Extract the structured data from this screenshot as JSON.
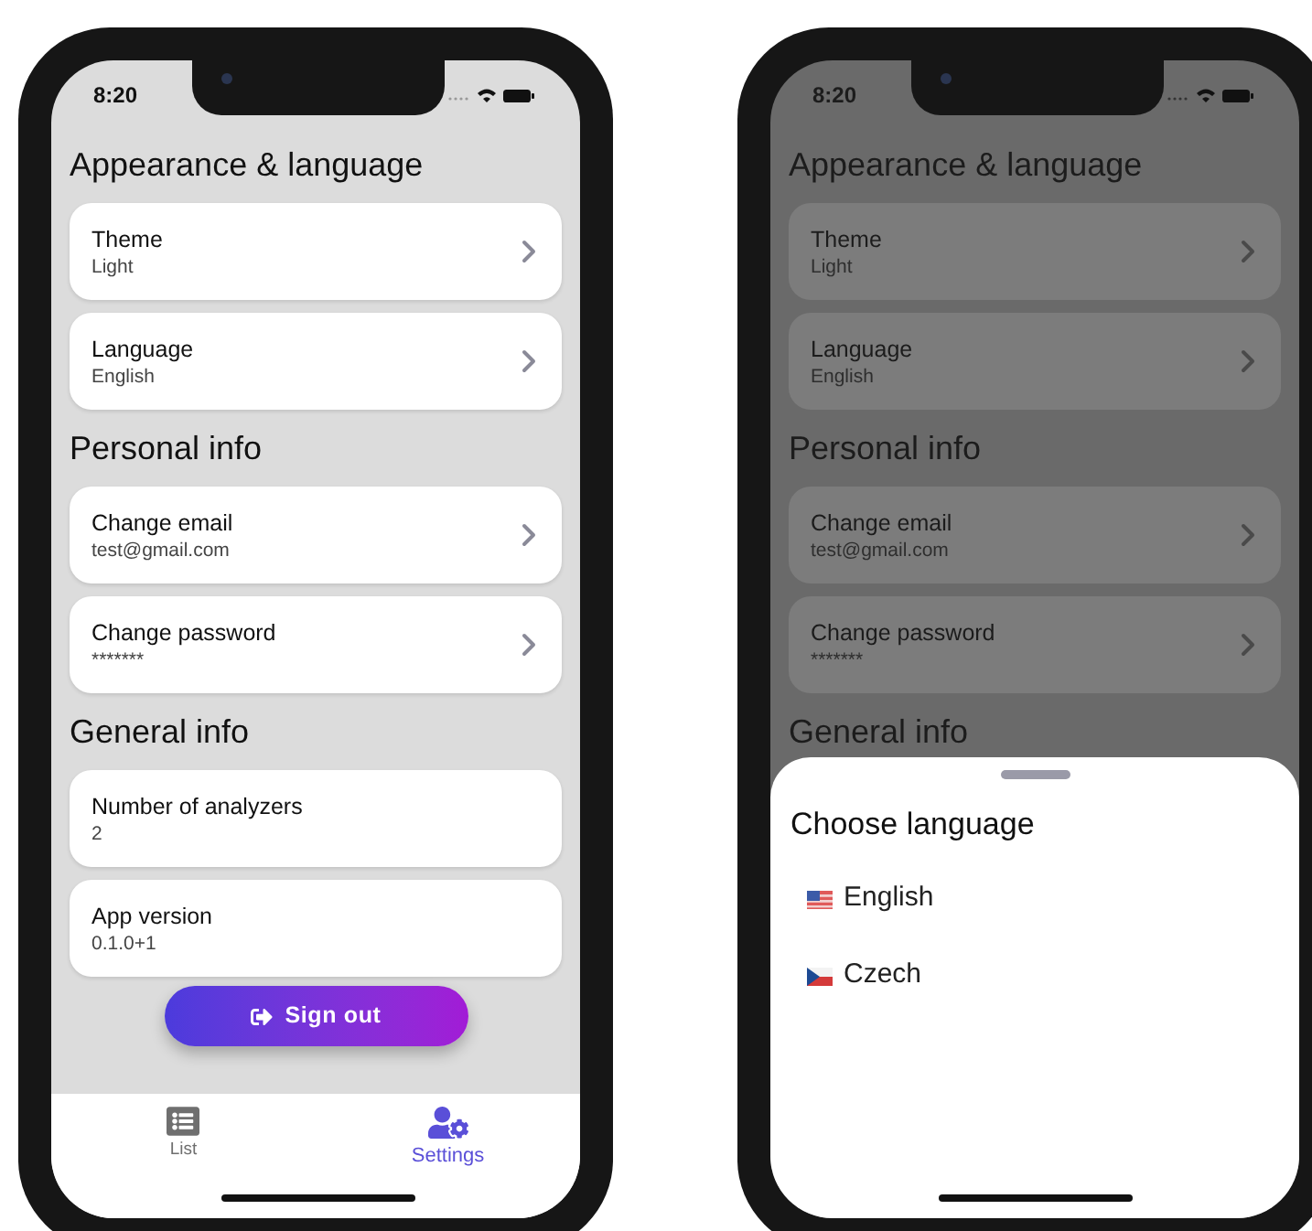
{
  "phones": [
    {
      "dimmed": false,
      "time": "8:20",
      "sections": [
        {
          "title": "Appearance & language",
          "items": [
            {
              "label": "Theme",
              "value": "Light",
              "link": true
            },
            {
              "label": "Language",
              "value": "English",
              "link": true
            }
          ]
        },
        {
          "title": "Personal info",
          "items": [
            {
              "label": "Change email",
              "value": "test@gmail.com",
              "link": true
            },
            {
              "label": "Change password",
              "value": "*******",
              "link": true
            }
          ]
        },
        {
          "title": "General info",
          "items": [
            {
              "label": "Number of analyzers",
              "value": "2",
              "link": false
            },
            {
              "label": "App version",
              "value": "0.1.0+1",
              "link": false
            }
          ]
        }
      ],
      "sign_out": "Sign out",
      "nav": [
        {
          "label": "List",
          "kind": "list",
          "selected": false
        },
        {
          "label": "Settings",
          "kind": "settings",
          "selected": true
        }
      ]
    },
    {
      "dimmed": true,
      "time": "8:20",
      "sections": [
        {
          "title": "Appearance & language",
          "items": [
            {
              "label": "Theme",
              "value": "Light",
              "link": true
            },
            {
              "label": "Language",
              "value": "English",
              "link": true
            }
          ]
        },
        {
          "title": "Personal info",
          "items": [
            {
              "label": "Change email",
              "value": "test@gmail.com",
              "link": true
            },
            {
              "label": "Change password",
              "value": "*******",
              "link": true
            }
          ]
        },
        {
          "title": "General info"
        }
      ],
      "sheet": {
        "title": "Choose language",
        "options": [
          {
            "label": "English",
            "kind": "us"
          },
          {
            "label": "Czech",
            "kind": "cz"
          }
        ]
      }
    }
  ]
}
